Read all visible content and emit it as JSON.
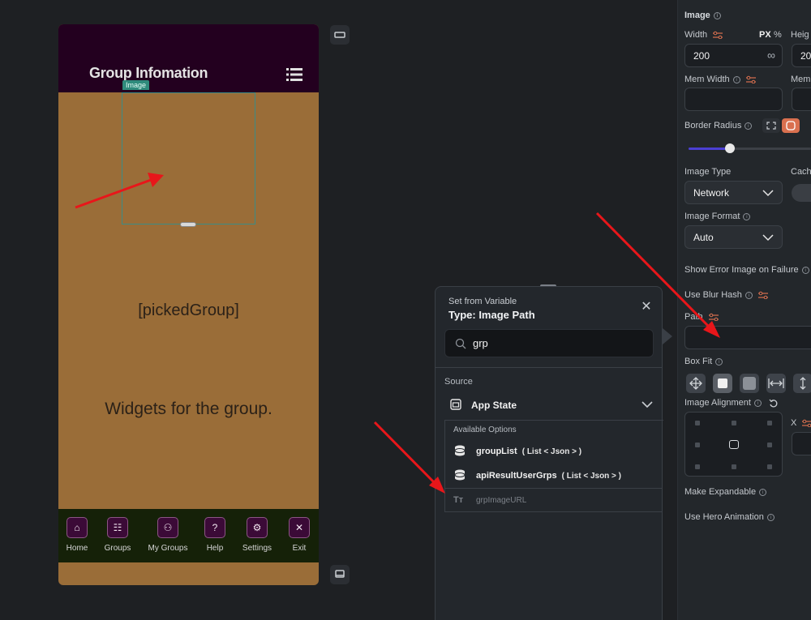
{
  "phone": {
    "app_title": "Group Infomation",
    "image_tag": "Image",
    "picked_group": "[pickedGroup]",
    "widgets_text": "Widgets for the group.",
    "nav": [
      {
        "label": "Home",
        "icon": "home-icon",
        "glyph": "⌂"
      },
      {
        "label": "Groups",
        "icon": "groups-icon",
        "glyph": "☷"
      },
      {
        "label": "My Groups",
        "icon": "my-groups-icon",
        "glyph": "⚇"
      },
      {
        "label": "Help",
        "icon": "help-icon",
        "glyph": "?"
      },
      {
        "label": "Settings",
        "icon": "settings-icon",
        "glyph": "⚙"
      },
      {
        "label": "Exit",
        "icon": "exit-icon",
        "glyph": "✕"
      }
    ]
  },
  "popup": {
    "subtitle": "Set from Variable",
    "title": "Type: Image Path",
    "search_value": "grp",
    "source_label": "Source",
    "app_state": "App State",
    "available_options": "Available Options",
    "options": [
      {
        "name": "groupList",
        "type": "( List < Json > )"
      },
      {
        "name": "apiResultUserGrps",
        "type": "( List < Json > )"
      },
      {
        "name": "grpImageURL",
        "type": ""
      }
    ],
    "text_type_glyph": "Tт"
  },
  "panel": {
    "section": "Image",
    "width_label": "Width",
    "unit_px": "PX",
    "unit_pct": "%",
    "height_label": "Heig",
    "width_value": "200",
    "height_value": "20",
    "infinity": "∞",
    "mem_width_label": "Mem Width",
    "mem_height_label": "Mem",
    "border_radius_label": "Border Radius",
    "image_type_label": "Image Type",
    "cache_label": "Cach",
    "image_type_value": "Network",
    "image_format_label": "Image Format",
    "image_format_value": "Auto",
    "show_error_label": "Show Error Image on Failure",
    "blur_hash_label": "Use Blur Hash",
    "path_label": "Path",
    "box_fit_label": "Box Fit",
    "alignment_label": "Image Alignment",
    "x_label": "X",
    "expandable_label": "Make Expandable",
    "hero_label": "Use Hero Animation"
  },
  "colors": {
    "phone_body": "#9a6d38",
    "appbar": "#23001f",
    "navbar": "#152108",
    "accent_radius": "#d9704f",
    "arrow": "#e8161a"
  }
}
